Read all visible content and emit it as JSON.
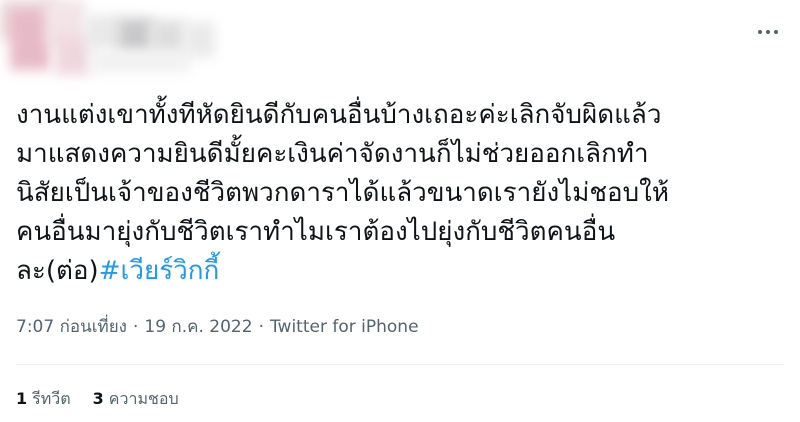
{
  "tweet": {
    "more_icon": "more-horizontal-icon",
    "text_lines": [
      "งานแต่งเขาทั้งทีหัดยินดีกับคนอื่นบ้างเถอะค่ะเลิกจับผิดแล้ว",
      "มาแสดงความยินดีมั้ยคะเงินค่าจัดงานก็ไม่ช่วยออกเลิกทำ",
      "นิสัยเป็นเจ้าของชีวิตพวกดาราได้แล้วขนาดเรายังไม่ชอบให้",
      "คนอื่นมายุ่งกับชีวิตเราทำไมเราต้องไปยุ่งกับชีวิตคนอื่น"
    ],
    "last_line_prefix": "ละ(ต่อ)",
    "hashtag": "#เวียร์วิกกี้",
    "time": "7:07 ก่อนเที่ยง",
    "date": "19 ก.ค. 2022",
    "source": "Twitter for iPhone",
    "separator": "·",
    "retweets_count": "1",
    "retweets_label": "รีทวีต",
    "likes_count": "3",
    "likes_label": "ความชอบ"
  },
  "colors": {
    "text": "#0f1419",
    "secondary": "#536471",
    "link": "#1d9bf0",
    "divider": "#eff3f4"
  }
}
